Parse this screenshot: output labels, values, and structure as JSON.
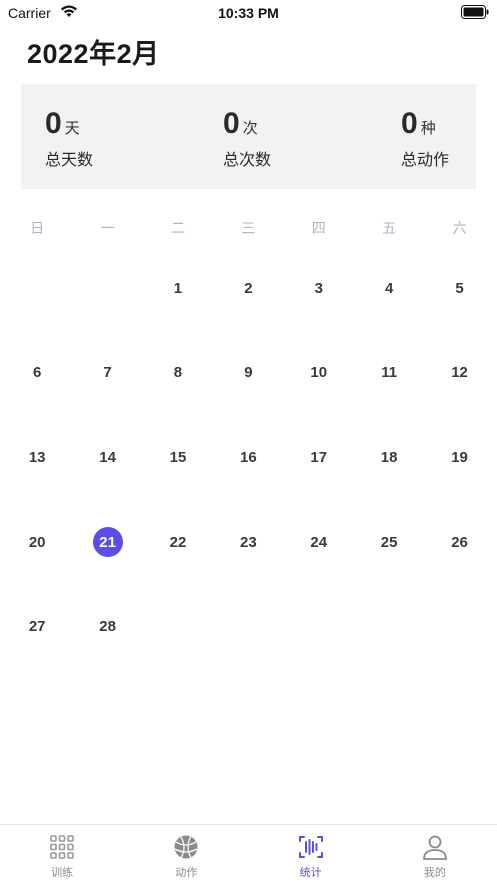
{
  "status": {
    "carrier": "Carrier",
    "time": "10:33 PM"
  },
  "title": "2022年2月",
  "summary": [
    {
      "value": "0",
      "unit": "天",
      "label": "总天数"
    },
    {
      "value": "0",
      "unit": "次",
      "label": "总次数"
    },
    {
      "value": "0",
      "unit": "种",
      "label": "总动作"
    }
  ],
  "weekdays": [
    "日",
    "一",
    "二",
    "三",
    "四",
    "五",
    "六"
  ],
  "calendar": {
    "rows": [
      [
        "",
        "",
        "1",
        "2",
        "3",
        "4",
        "5"
      ],
      [
        "6",
        "7",
        "8",
        "9",
        "10",
        "11",
        "12"
      ],
      [
        "13",
        "14",
        "15",
        "16",
        "17",
        "18",
        "19"
      ],
      [
        "20",
        "21",
        "22",
        "23",
        "24",
        "25",
        "26"
      ],
      [
        "27",
        "28",
        "",
        "",
        "",
        "",
        ""
      ]
    ],
    "selected": "21"
  },
  "tabs": [
    {
      "label": "训练",
      "icon": "grid-icon"
    },
    {
      "label": "动作",
      "icon": "ball-icon"
    },
    {
      "label": "统计",
      "icon": "stats-icon",
      "active": true
    },
    {
      "label": "我的",
      "icon": "user-icon"
    }
  ],
  "colors": {
    "accent": "#5b4ee8",
    "card_bg": "#f2f2f2",
    "weekday": "#a9b6c8"
  }
}
